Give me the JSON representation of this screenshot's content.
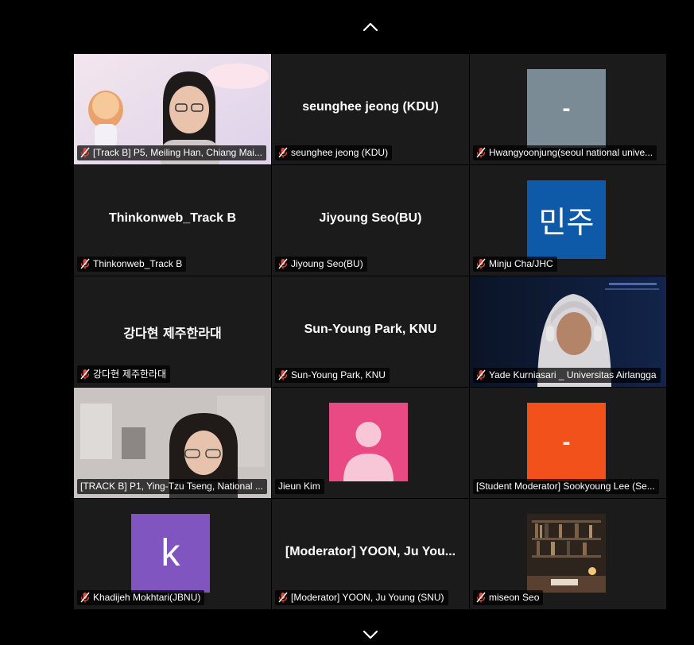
{
  "navigation": {
    "up_icon": "chevron-up-icon",
    "down_icon": "chevron-down-icon"
  },
  "colors": {
    "tile_background": "#1b1b1b",
    "speaking_border": "#4ec24b",
    "mic_muted": "#e0453a",
    "avatar_grey": "#7a8b96",
    "avatar_blue": "#0f5aa8",
    "avatar_pink": "#ea4a84",
    "avatar_orange": "#f2511b",
    "avatar_purple": "#8055c0"
  },
  "participants": [
    {
      "label": "[Track B] P5, Meiling Han, Chiang Mai...",
      "display": "video",
      "muted": true
    },
    {
      "label": "seunghee jeong (KDU)",
      "center_name": "seunghee jeong (KDU)",
      "display": "name",
      "muted": true
    },
    {
      "label": "Hwangyoonjung(seoul national unive...",
      "avatar_text": "-",
      "display": "avatar",
      "muted": true
    },
    {
      "label": "Thinkonweb_Track B",
      "center_name": "Thinkonweb_Track B",
      "display": "name",
      "muted": true
    },
    {
      "label": "Jiyoung Seo(BU)",
      "center_name": "Jiyoung Seo(BU)",
      "display": "name",
      "muted": true
    },
    {
      "label": "Minju Cha/JHC",
      "avatar_text": "민주",
      "display": "avatar",
      "muted": true
    },
    {
      "label": "강다현 제주한라대",
      "center_name": "강다현 제주한라대",
      "display": "name",
      "muted": true
    },
    {
      "label": "Sun-Young Park, KNU",
      "center_name": "Sun-Young Park, KNU",
      "display": "name",
      "muted": true
    },
    {
      "label": "Yade Kurniasari _ Universitas Airlangga",
      "display": "video",
      "muted": true
    },
    {
      "label": "[TRACK B] P1, Ying-Tzu Tseng, National ...",
      "display": "video",
      "muted": false,
      "speaking": true
    },
    {
      "label": "Jieun Kim",
      "avatar_text": "",
      "display": "avatar",
      "muted": false
    },
    {
      "label": "[Student Moderator] Sookyoung Lee (Se...",
      "avatar_text": "-",
      "display": "avatar",
      "muted": false
    },
    {
      "label": "Khadijeh Mokhtari(JBNU)",
      "avatar_text": "k",
      "display": "avatar",
      "muted": true
    },
    {
      "label": "[Moderator] YOON, Ju Young (SNU)",
      "center_name": "[Moderator] YOON, Ju You...",
      "display": "name",
      "muted": true
    },
    {
      "label": "miseon Seo",
      "display": "photo",
      "muted": true
    }
  ]
}
